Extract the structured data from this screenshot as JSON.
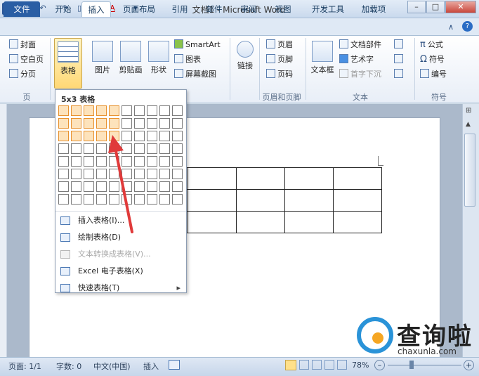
{
  "window": {
    "title": "文档1 - Microsoft Word",
    "logo": "W",
    "min": "–",
    "max": "□",
    "close": "✕"
  },
  "qat": {
    "save_icon": "save-icon",
    "undo": "↶",
    "redo": "↷",
    "omega": "Ω",
    "font_color": "A",
    "more": "▾"
  },
  "tabs": [
    "文件",
    "开始",
    "插入",
    "页面布局",
    "引用",
    "邮件",
    "审阅",
    "视图",
    "开发工具",
    "加载项"
  ],
  "help": "?",
  "ribbon": {
    "pages_group": {
      "items": [
        "封面",
        "空白页",
        "分页"
      ],
      "label": "页"
    },
    "table_button": "表格",
    "illustrations": [
      "图片",
      "剪贴画",
      "形状"
    ],
    "illus_small": [
      "SmartArt",
      "图表",
      "屏幕截图"
    ],
    "link": "链接",
    "header_footer": {
      "items": [
        "页眉",
        "页脚",
        "页码"
      ],
      "label": "页眉和页脚"
    },
    "text": {
      "textbox": "文本框",
      "items": [
        "文档部件",
        "艺术字",
        "首字下沉"
      ],
      "label": "文本"
    },
    "symbols": {
      "items": [
        "公式",
        "符号",
        "编号"
      ],
      "label": "符号"
    }
  },
  "dropdown": {
    "title": "5x3 表格",
    "grid": {
      "cols": 10,
      "rows": 8,
      "sel_cols": 5,
      "sel_rows": 3
    },
    "items": [
      {
        "label": "插入表格(I)...",
        "disabled": false
      },
      {
        "label": "绘制表格(D)",
        "disabled": false
      },
      {
        "label": "文本转换成表格(V)...",
        "disabled": true
      },
      {
        "label": "Excel 电子表格(X)",
        "disabled": false
      },
      {
        "label": "快速表格(T)",
        "disabled": false
      }
    ]
  },
  "doc_table": {
    "rows": 3,
    "cols": 5
  },
  "status": {
    "page": "页面: 1/1",
    "words": "字数: 0",
    "lang": "中文(中国)",
    "mode": "插入",
    "zoom": "78%",
    "zoom_minus": "–",
    "zoom_plus": "+"
  },
  "watermark": {
    "text": "查询啦",
    "url": "chaxunla.com"
  },
  "colors": {
    "file_tab": "#2a5ea4",
    "grid_highlight": "#e7912e",
    "arrow": "#e03a3a"
  }
}
